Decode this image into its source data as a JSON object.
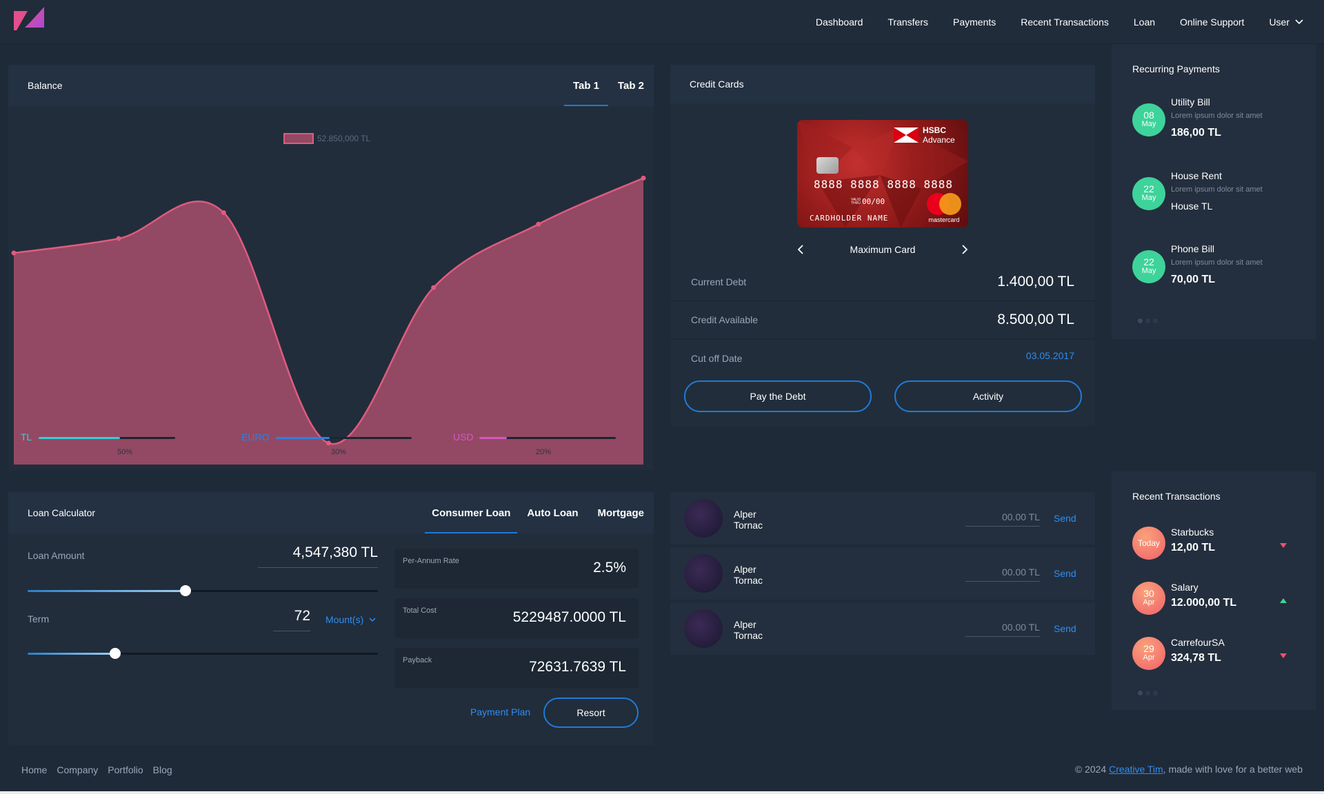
{
  "nav": {
    "items": [
      "Dashboard",
      "Transfers",
      "Payments",
      "Recent Transactions",
      "Loan",
      "Online Support"
    ],
    "user_label": "User"
  },
  "balance": {
    "title": "Balance",
    "tabs": [
      "Tab 1",
      "Tab 2"
    ],
    "chart_data": {
      "type": "area",
      "legend": [
        "52.850,000 TL"
      ],
      "x": [
        0,
        1,
        2,
        3,
        4,
        5,
        6
      ],
      "values": [
        72,
        77,
        86,
        6,
        60,
        82,
        98
      ],
      "ylim": [
        0,
        100
      ],
      "color": "#e05b7f"
    },
    "currencies": [
      {
        "label": "TL",
        "percent": 60,
        "color": "#2ed1d8",
        "caption": "50%"
      },
      {
        "label": "EURO",
        "percent": 40,
        "color": "#2f7fe0",
        "caption": "30%"
      },
      {
        "label": "USD",
        "percent": 20,
        "color": "#d258c4",
        "caption": "20%"
      }
    ]
  },
  "credit": {
    "title": "Credit Cards",
    "card": {
      "bank": "HSBC",
      "tier": "Advance",
      "number": "8888 8888 8888 8888",
      "valid_label": "VALID THRU",
      "expiry": "00/00",
      "holder": "CARDHOLDER NAME",
      "network": "mastercard"
    },
    "card_name": "Maximum Card",
    "rows": [
      {
        "label": "Current Debt",
        "value": "1.400,00 TL"
      },
      {
        "label": "Credit Available",
        "value": "8.500,00 TL"
      },
      {
        "label": "Cut off Date",
        "value": "03.05.2017"
      }
    ],
    "pay_label": "Pay the Debt",
    "activity_label": "Activity"
  },
  "recurring": {
    "title": "Recurring Payments",
    "items": [
      {
        "day": "08",
        "month": "May",
        "name": "Utility Bill",
        "desc": "Lorem ipsum dolor sit amet",
        "amount": "186,00 TL",
        "bold": true
      },
      {
        "day": "22",
        "month": "May",
        "name": "House Rent",
        "desc": "Lorem ipsum dolor sit amet",
        "amount": "House TL",
        "bold": false
      },
      {
        "day": "22",
        "month": "May",
        "name": "Phone Bill",
        "desc": "Lorem ipsum dolor sit amet",
        "amount": "70,00 TL",
        "bold": true
      }
    ]
  },
  "transfers": {
    "rows": [
      {
        "first": "Alper",
        "last": "Tornac",
        "amount": "00.00 TL",
        "send": "Send"
      },
      {
        "first": "Alper",
        "last": "Tornac",
        "amount": "00.00 TL",
        "send": "Send"
      },
      {
        "first": "Alper",
        "last": "Tornac",
        "amount": "00.00 TL",
        "send": "Send"
      }
    ]
  },
  "loan": {
    "title": "Loan Calculator",
    "tabs": [
      "Consumer Loan",
      "Auto Loan",
      "Mortgage"
    ],
    "amount_label": "Loan Amount",
    "amount_value": "4,547,380 TL",
    "amount_fraction": 0.45,
    "term_label": "Term",
    "term_value": "72",
    "term_unit": "Mount(s)",
    "term_fraction": 0.25,
    "results": [
      {
        "label": "Per-Annum Rate",
        "value": "2.5%"
      },
      {
        "label": "Total Cost",
        "value": "5229487.0000 TL"
      },
      {
        "label": "Payback",
        "value": "72631.7639 TL"
      }
    ],
    "plan_label": "Payment Plan",
    "resort_label": "Resort"
  },
  "recent": {
    "title": "Recent Transactions",
    "items": [
      {
        "day": "Today",
        "month": "",
        "name": "Starbucks",
        "amount": "12,00 TL",
        "dir": "down"
      },
      {
        "day": "30",
        "month": "Apr",
        "name": "Salary",
        "amount": "12.000,00 TL",
        "dir": "up"
      },
      {
        "day": "29",
        "month": "Apr",
        "name": "CarrefourSA",
        "amount": "324,78 TL",
        "dir": "down"
      }
    ]
  },
  "footer": {
    "links": [
      "Home",
      "Company",
      "Portfolio",
      "Blog"
    ],
    "copy_prefix": "© 2024 ",
    "copy_link": "Creative Tim",
    "copy_suffix": ", made with love for a better web"
  },
  "colors": {
    "accent": "#1e7bd6",
    "green_badge": "#3ed39a",
    "orange_badge": "#f36f6f",
    "chart": "#e05b7f"
  }
}
